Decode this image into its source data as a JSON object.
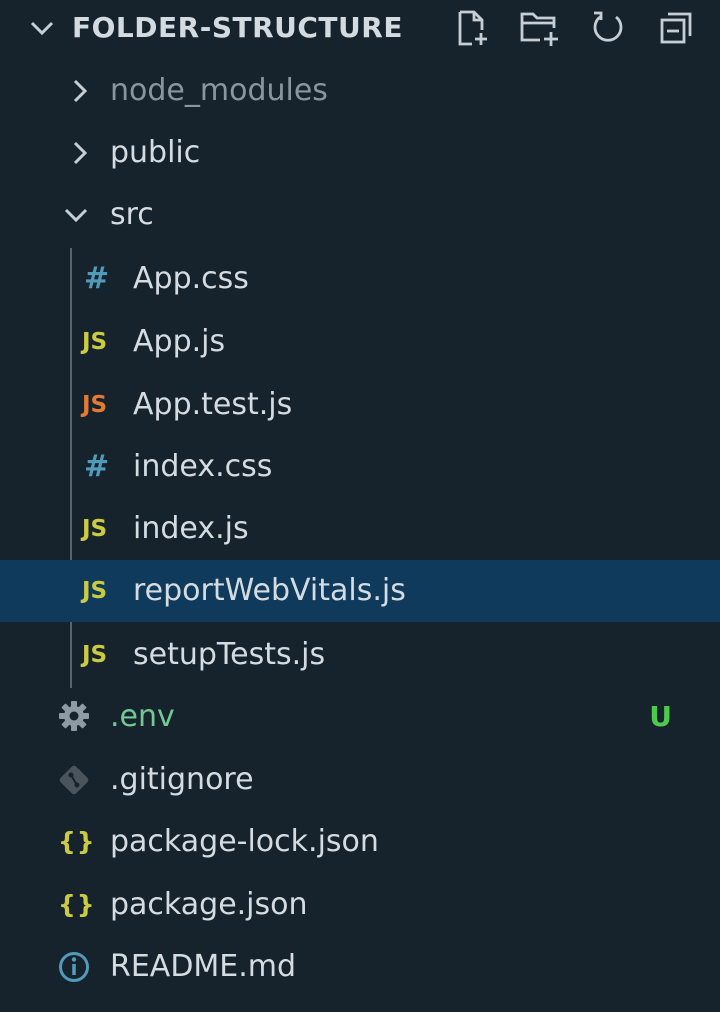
{
  "explorer": {
    "title": "FOLDER-STRUCTURE",
    "toolbar": {
      "new_file_icon": "new-file-icon",
      "new_folder_icon": "new-folder-icon",
      "refresh_icon": "refresh-icon",
      "collapse_all_icon": "collapse-all-icon"
    },
    "tree": [
      {
        "label": "node_modules",
        "type": "folder",
        "expanded": false
      },
      {
        "label": "public",
        "type": "folder",
        "expanded": false
      },
      {
        "label": "src",
        "type": "folder",
        "expanded": true
      },
      {
        "label": "App.css",
        "type": "file",
        "icon": "#"
      },
      {
        "label": "App.js",
        "type": "file",
        "icon": "JS"
      },
      {
        "label": "App.test.js",
        "type": "file",
        "icon": "JS"
      },
      {
        "label": "index.css",
        "type": "file",
        "icon": "#"
      },
      {
        "label": "index.js",
        "type": "file",
        "icon": "JS"
      },
      {
        "label": "reportWebVitals.js",
        "type": "file",
        "icon": "JS",
        "selected": true
      },
      {
        "label": "setupTests.js",
        "type": "file",
        "icon": "JS"
      },
      {
        "label": ".env",
        "type": "file",
        "icon": "gear-icon",
        "badge": "U"
      },
      {
        "label": ".gitignore",
        "type": "file",
        "icon": "git-icon"
      },
      {
        "label": "package-lock.json",
        "type": "file",
        "icon": "{}"
      },
      {
        "label": "package.json",
        "type": "file",
        "icon": "{}"
      },
      {
        "label": "README.md",
        "type": "file",
        "icon": "info-icon"
      }
    ]
  },
  "colors": {
    "background": "#16232d",
    "selected_row": "#0f3a5b",
    "js_icon": "#cbcb41",
    "test_icon": "#e37933",
    "css_icon": "#519aba",
    "untracked": "#73c991",
    "badge": "#4ec94e"
  }
}
